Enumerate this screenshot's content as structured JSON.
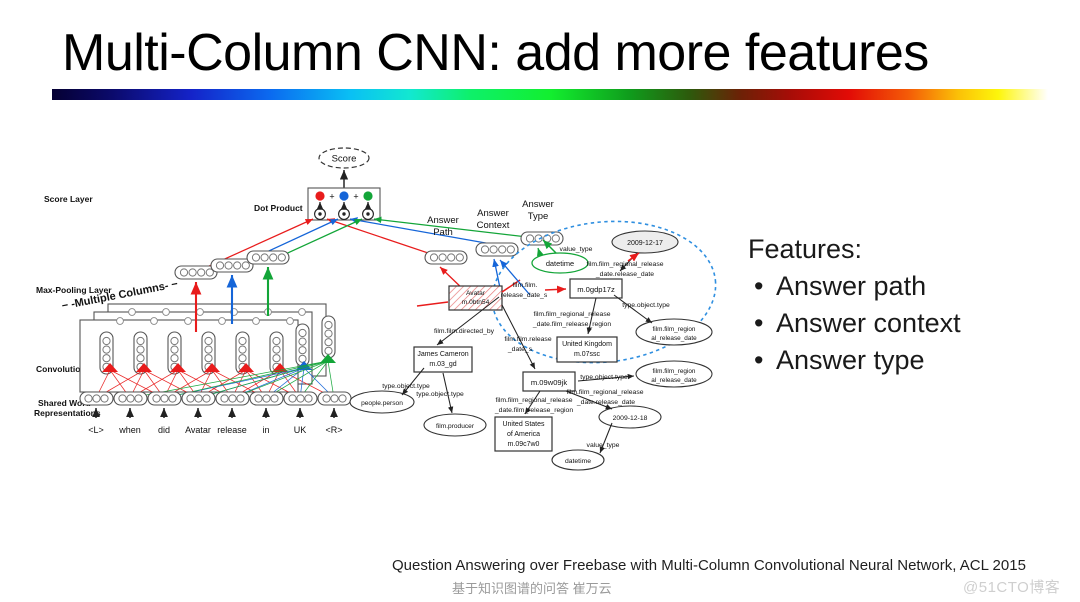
{
  "slide": {
    "title": "Multi-Column CNN: add more features",
    "background": "#ffffff",
    "accent_bar": "rainbow-gradient"
  },
  "features_panel": {
    "heading": "Features:",
    "bullet_glyph": "•",
    "items": [
      "Answer path",
      "Answer context",
      "Answer type"
    ]
  },
  "footer": {
    "citation": "Question Answering over Freebase with Multi-Column Convolutional Neural Network, ACL 2015",
    "subtitle": "基于知识图谱的问答 崔万云",
    "watermark": "@51CTO博客"
  },
  "diagram": {
    "layer_labels": [
      "Score Layer",
      "Max-Pooling Layer",
      "Convolutional Layer",
      "Shared Word",
      "Representations",
      "Dot Product"
    ],
    "multiple_columns_label": "-Multiple Columns-",
    "score_node": "Score",
    "plus_signs": [
      "+",
      "+"
    ],
    "column_colors": {
      "answer_path": "#e81c1c",
      "answer_context": "#1565d8",
      "answer_type": "#13a538"
    },
    "vector_labels": [
      {
        "line1": "Answer",
        "line2": "Path"
      },
      {
        "line1": "Answer",
        "line2": "Context"
      },
      {
        "line1": "Answer",
        "line2": "Type"
      }
    ],
    "question_tokens": [
      "<L>",
      "when",
      "did",
      "Avatar",
      "release",
      "in",
      "UK",
      "<R>"
    ],
    "highlight_ellipse_color": "#2f8fe0"
  },
  "knowledge_graph": {
    "entity_nodes": [
      {
        "id": "avatar",
        "label_line1": "Avatar",
        "label_line2": "m.0btn54",
        "shape": "box-hatched"
      },
      {
        "id": "james-cameron",
        "label_line1": "James Cameron",
        "label_line2": "m.03_gd",
        "shape": "box"
      },
      {
        "id": "united-kingdom",
        "label_line1": "United Kingdom",
        "label_line2": "m.07ssc",
        "shape": "box"
      },
      {
        "id": "united-states",
        "label_line1": "United States",
        "label_line2": "of America",
        "label_line3": "m.09c7w0",
        "shape": "box"
      },
      {
        "id": "cvt-gdp17z",
        "label_line1": "m.0gdp17z",
        "shape": "box"
      },
      {
        "id": "cvt-09w09jk",
        "label_line1": "m.09w09jk",
        "shape": "box"
      }
    ],
    "value_nodes": [
      {
        "id": "date-2009-12-17",
        "label": "2009-12-17",
        "shape": "ellipse-filled"
      },
      {
        "id": "date-2009-12-18",
        "label": "2009-12-18",
        "shape": "ellipse"
      },
      {
        "id": "datetime-top",
        "label": "datetime",
        "shape": "ellipse-green"
      },
      {
        "id": "datetime-bottom",
        "label": "datetime",
        "shape": "ellipse"
      },
      {
        "id": "people-person",
        "label": "people.person",
        "shape": "ellipse"
      },
      {
        "id": "film-producer",
        "label": "film.producer",
        "shape": "ellipse"
      },
      {
        "id": "film-region-1",
        "label_line1": "film.film_region",
        "label_line2": "al_release_date",
        "shape": "ellipse"
      },
      {
        "id": "film-region-2",
        "label_line1": "film.film_region",
        "label_line2": "al_release_date",
        "shape": "ellipse"
      }
    ],
    "edge_labels": [
      {
        "id": "value-type-top",
        "text": "value_type"
      },
      {
        "id": "value-type-bottom",
        "text": "value_type"
      },
      {
        "id": "film-release-date-s-1",
        "line1": "film.film.",
        "line2": "release_date_s"
      },
      {
        "id": "film-release-date-s-2",
        "line1": "film.film.release",
        "line2": "_date_s"
      },
      {
        "id": "film-directed-by",
        "text": "film.film.directed_by"
      },
      {
        "id": "regional-release-date-1",
        "line1": "film.film_regional_release",
        "line2": "_date.release_date"
      },
      {
        "id": "regional-release-date-2",
        "line1": "film.film_regional_release",
        "line2": "_date.release_date"
      },
      {
        "id": "regional-release-region-1",
        "line1": "film.film_regional_release",
        "line2": "_date.film_release_region"
      },
      {
        "id": "regional-release-region-2",
        "line1": "film.film_regional_release",
        "line2": "_date.film_release_region"
      },
      {
        "id": "type-object-type-1",
        "text": "type.object.type"
      },
      {
        "id": "type-object-type-2",
        "text": "type.object.type"
      },
      {
        "id": "type-object-type-3",
        "text": "type.object.type"
      },
      {
        "id": "type-object-type-4",
        "text": "type.object.type"
      }
    ]
  }
}
